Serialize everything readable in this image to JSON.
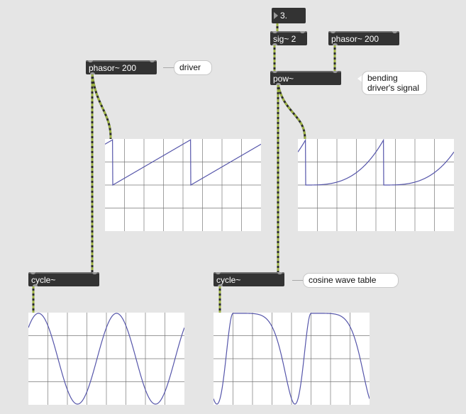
{
  "colors": {
    "background": "#e5e5e5",
    "object_box": "#333333",
    "signal_cable_green": "#9bb043",
    "signal_cable_dark": "#2b2b2b",
    "scope_trace": "#5555aa",
    "scope_grid": "#777777"
  },
  "objects": {
    "number_box": "3.",
    "sig": "sig~ 2",
    "phasor_right": "phasor~ 200",
    "pow": "pow~",
    "phasor_left": "phasor~ 200",
    "cycle_left": "cycle~",
    "cycle_right": "cycle~"
  },
  "comments": {
    "driver": "driver",
    "bending": "bending driver's signal",
    "cosine": "cosine wave table"
  },
  "scopes": {
    "grid": {
      "columns": 8,
      "rows": 4
    },
    "left_phasor": {
      "waveform": "sawtooth",
      "exponent": 1
    },
    "right_pow": {
      "waveform": "sawtooth-power",
      "exponent": 3
    },
    "left_cycle": {
      "waveform": "cosine"
    },
    "right_cycle": {
      "waveform": "cosine-of-power"
    }
  }
}
